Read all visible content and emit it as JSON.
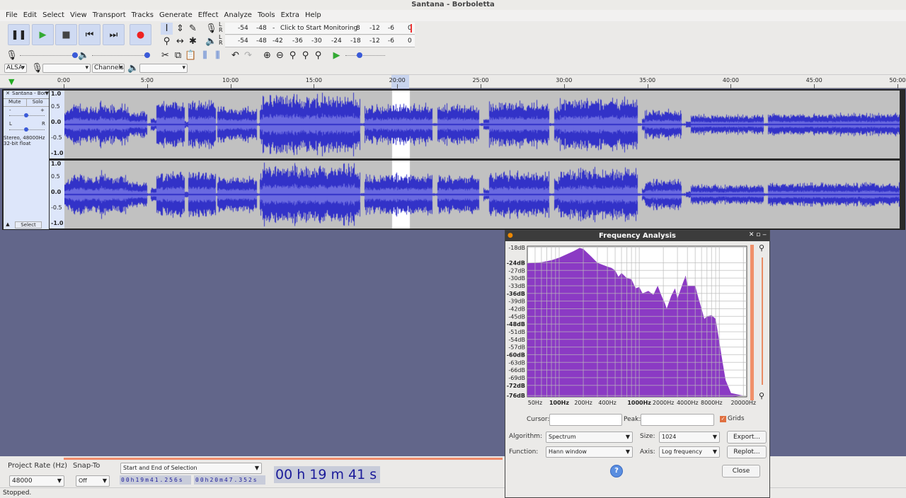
{
  "window": {
    "title": "Santana - Borboletta"
  },
  "menu": [
    "File",
    "Edit",
    "Select",
    "View",
    "Transport",
    "Tracks",
    "Generate",
    "Effect",
    "Analyze",
    "Tools",
    "Extra",
    "Help"
  ],
  "meters": {
    "record_ticks": [
      "-54",
      "-48",
      "-",
      "Click to Start Monitoring",
      "8",
      "-12",
      "-6",
      "0"
    ],
    "play_ticks": [
      "-54",
      "-48",
      "-42",
      "-36",
      "-30",
      "-24",
      "-18",
      "-12",
      "-6",
      "0"
    ],
    "lr": [
      "L",
      "R"
    ]
  },
  "device": {
    "host": "ALSA",
    "channels": "Channels"
  },
  "ruler": {
    "ticks": [
      "0:00",
      "5:00",
      "10:00",
      "15:00",
      "20:00",
      "25:00",
      "30:00",
      "35:00",
      "40:00",
      "45:00",
      "50:00"
    ]
  },
  "track": {
    "name": "Santana - Borboletta",
    "mute": "Mute",
    "solo": "Solo",
    "gain_minus": "-",
    "gain_plus": "+",
    "pan_l": "L",
    "pan_r": "R",
    "info1": "Stereo, 48000Hz",
    "info2": "32-bit float",
    "select": "Select",
    "scale": [
      "1.0",
      "0.5",
      "0.0",
      "-0.5",
      "-1.0"
    ]
  },
  "wave_color": "#3232c8",
  "freq": {
    "title": "Frequency Analysis",
    "db_ticks": [
      "-18dB",
      "-24dB",
      "-27dB",
      "-30dB",
      "-33dB",
      "-36dB",
      "-39dB",
      "-42dB",
      "-45dB",
      "-48dB",
      "-51dB",
      "-54dB",
      "-57dB",
      "-60dB",
      "-63dB",
      "-66dB",
      "-69dB",
      "-72dB",
      "-76dB"
    ],
    "hz_ticks": [
      "50Hz",
      "100Hz",
      "200Hz",
      "400Hz",
      "1000Hz",
      "2000Hz",
      "4000Hz",
      "8000Hz",
      "20000Hz"
    ],
    "cursor_label": "Cursor:",
    "peak_label": "Peak:",
    "grids_label": "Grids",
    "algorithm_label": "Algorithm:",
    "algorithm": "Spectrum",
    "size_label": "Size:",
    "size": "1024",
    "export": "Export...",
    "function_label": "Function:",
    "function": "Hann window",
    "axis_label": "Axis:",
    "axis": "Log frequency",
    "replot": "Replot...",
    "help": "?",
    "close": "Close",
    "spectrum": [
      [
        40,
        -24.2
      ],
      [
        60,
        -23.8
      ],
      [
        80,
        -23
      ],
      [
        100,
        -22
      ],
      [
        150,
        -19.5
      ],
      [
        180,
        -18.2
      ],
      [
        200,
        -18.6
      ],
      [
        250,
        -21.5
      ],
      [
        300,
        -24
      ],
      [
        400,
        -25.5
      ],
      [
        450,
        -26
      ],
      [
        500,
        -27
      ],
      [
        550,
        -29.5
      ],
      [
        600,
        -28
      ],
      [
        700,
        -30
      ],
      [
        800,
        -30.5
      ],
      [
        900,
        -34
      ],
      [
        1000,
        -33.5
      ],
      [
        1100,
        -36
      ],
      [
        1300,
        -35
      ],
      [
        1500,
        -36.5
      ],
      [
        1700,
        -33
      ],
      [
        1900,
        -37
      ],
      [
        2100,
        -40
      ],
      [
        2200,
        -42
      ],
      [
        2500,
        -37
      ],
      [
        2800,
        -34
      ],
      [
        3000,
        -38
      ],
      [
        3500,
        -32
      ],
      [
        3800,
        -29
      ],
      [
        4000,
        -33
      ],
      [
        4500,
        -33
      ],
      [
        5000,
        -33
      ],
      [
        5500,
        -38
      ],
      [
        6000,
        -42
      ],
      [
        6500,
        -46
      ],
      [
        7000,
        -45
      ],
      [
        8000,
        -44.5
      ],
      [
        9000,
        -46
      ],
      [
        10000,
        -55
      ],
      [
        11000,
        -63
      ],
      [
        12000,
        -70
      ],
      [
        14000,
        -75
      ],
      [
        20000,
        -76
      ]
    ]
  },
  "bottom": {
    "rate_label": "Project Rate (Hz)",
    "rate": "48000",
    "snap_label": "Snap-To",
    "snap": "Off",
    "sel_mode": "Start and End of Selection",
    "sel_start": "00h19m41.256s",
    "sel_end": "00h20m47.352s",
    "audio_pos": "00 h 19 m 41 s"
  },
  "status": "Stopped."
}
